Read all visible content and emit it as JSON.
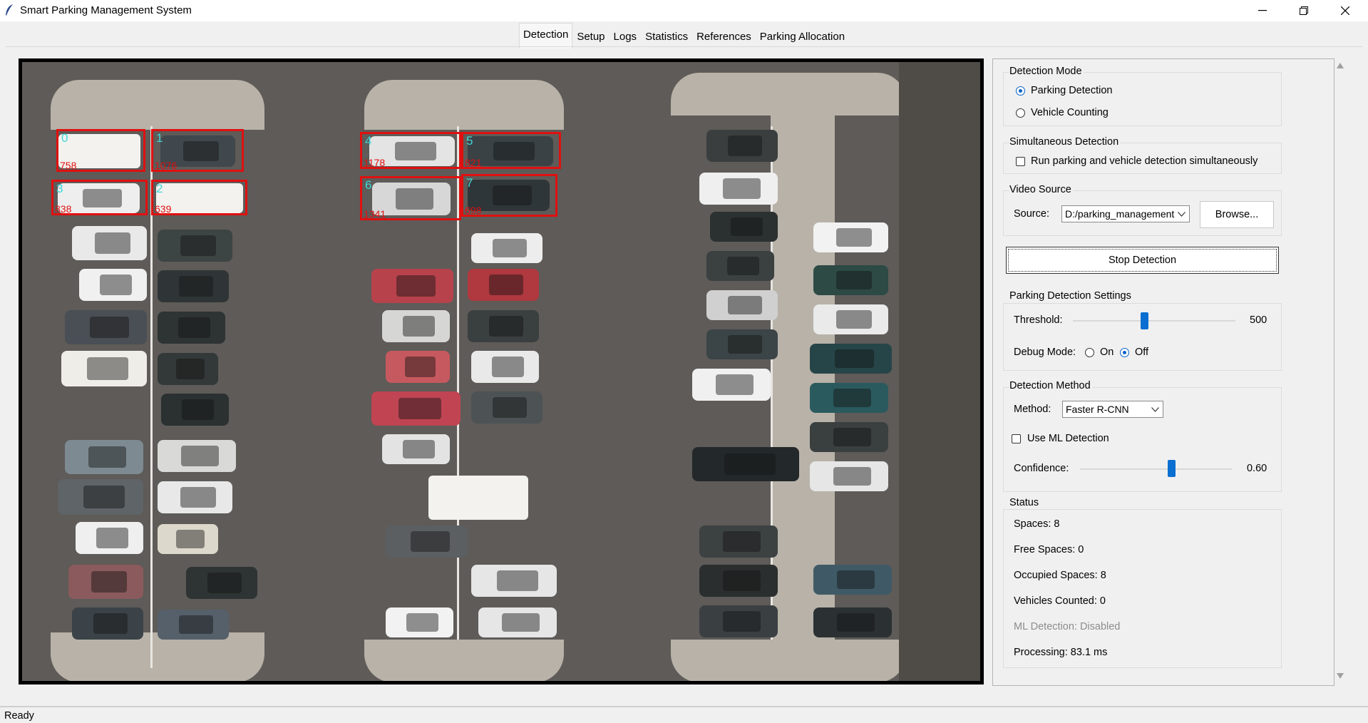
{
  "window": {
    "title": "Smart Parking Management System"
  },
  "tabs": [
    {
      "label": "Detection",
      "active": true
    },
    {
      "label": "Setup",
      "active": false
    },
    {
      "label": "Logs",
      "active": false
    },
    {
      "label": "Statistics",
      "active": false
    },
    {
      "label": "References",
      "active": false
    },
    {
      "label": "Parking Allocation",
      "active": false
    }
  ],
  "video": {
    "slots": [
      {
        "index": "0",
        "count": "758"
      },
      {
        "index": "1",
        "count": "1076"
      },
      {
        "index": "2",
        "count": "639"
      },
      {
        "index": "3",
        "count": "838"
      },
      {
        "index": "4",
        "count": "1178"
      },
      {
        "index": "5",
        "count": "821"
      },
      {
        "index": "6",
        "count": "1341"
      },
      {
        "index": "7",
        "count": "698"
      }
    ]
  },
  "detection_mode": {
    "label": "Detection Mode",
    "options": [
      {
        "label": "Parking Detection",
        "checked": true
      },
      {
        "label": "Vehicle Counting",
        "checked": false
      }
    ]
  },
  "simultaneous": {
    "label": "Simultaneous Detection",
    "checkbox_label": "Run parking and vehicle detection simultaneously",
    "checked": false
  },
  "video_source": {
    "label": "Video Source",
    "source_label": "Source:",
    "source_value": "D:/parking_management",
    "browse_label": "Browse..."
  },
  "stop_button": "Stop Detection",
  "parking_settings": {
    "label": "Parking Detection Settings",
    "threshold_label": "Threshold:",
    "threshold_value": "500",
    "threshold_fraction": 0.44,
    "debug_label": "Debug Mode:",
    "debug_on": "On",
    "debug_off": "Off",
    "debug_selected": "Off"
  },
  "detection_method": {
    "label": "Detection Method",
    "method_label": "Method:",
    "method_value": "Faster R-CNN",
    "ml_label": "Use ML Detection",
    "ml_checked": false,
    "confidence_label": "Confidence:",
    "confidence_value": "0.60",
    "confidence_fraction": 0.6
  },
  "status": {
    "label": "Status",
    "spaces": "Spaces: 8",
    "free": "Free Spaces: 0",
    "occupied": "Occupied Spaces: 8",
    "vehicles": "Vehicles Counted: 0",
    "ml": "ML Detection: Disabled",
    "processing": "Processing: 83.1 ms"
  },
  "statusbar": {
    "text": "Ready"
  }
}
